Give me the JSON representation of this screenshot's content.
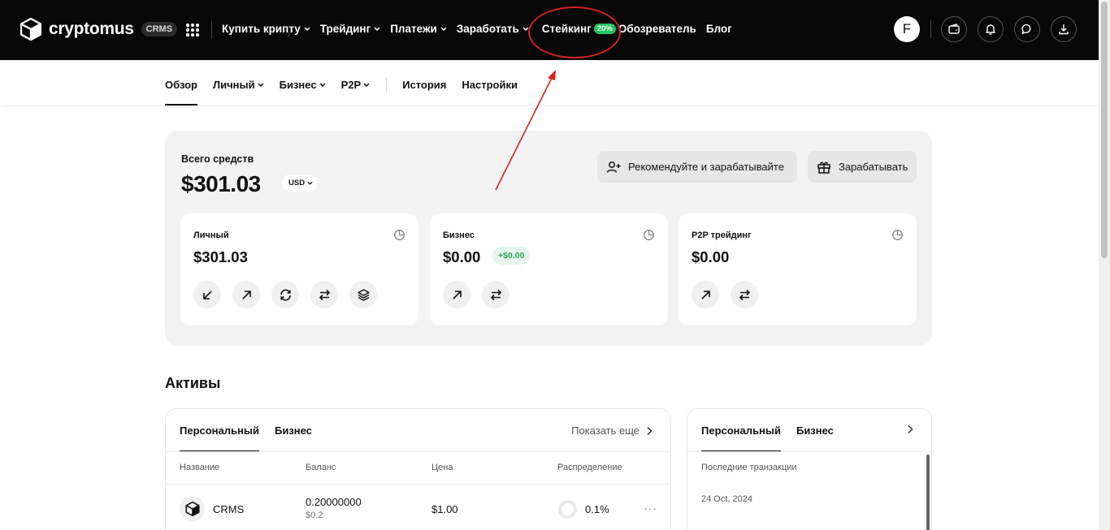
{
  "topbar": {
    "brand": "cryptomus",
    "brand_tag": "CRMS",
    "nav": [
      {
        "label": "Купить крипту",
        "dropdown": true
      },
      {
        "label": "Трейдинг",
        "dropdown": true
      },
      {
        "label": "Платежи",
        "dropdown": true
      },
      {
        "label": "Заработать",
        "dropdown": true
      },
      {
        "label": "Стейкинг",
        "badge": "20%"
      },
      {
        "label": "Обозреватель"
      },
      {
        "label": "Блог"
      }
    ],
    "avatar_letter": "F",
    "icons": [
      "wallet-icon",
      "bell-icon",
      "chat-icon",
      "download-icon"
    ]
  },
  "subnav": {
    "items": [
      {
        "label": "Обзор",
        "active": true
      },
      {
        "label": "Личный",
        "dropdown": true
      },
      {
        "label": "Бизнес",
        "dropdown": true
      },
      {
        "label": "P2P",
        "dropdown": true
      },
      {
        "label": "История"
      },
      {
        "label": "Настройки"
      }
    ]
  },
  "balance": {
    "total_label": "Всего средств",
    "total_amount": "$301.03",
    "currency": "USD",
    "refer_label": "Рекомендуйте и зарабатывайте",
    "earn_label": "Зарабатывать",
    "cards": [
      {
        "label": "Личный",
        "amount": "$301.03"
      },
      {
        "label": "Бизнес",
        "amount": "$0.00",
        "delta": "+$0.00"
      },
      {
        "label": "P2P трейдинг",
        "amount": "$0.00"
      }
    ]
  },
  "assets": {
    "title": "Активы",
    "tabs": [
      "Персональный",
      "Бизнес"
    ],
    "show_more": "Показать еще",
    "columns": [
      "Название",
      "Баланс",
      "Цена",
      "Распределение"
    ],
    "rows": [
      {
        "name": "CRMS",
        "balance": "0.20000000",
        "balance_usd": "$0.2",
        "price": "$1.00",
        "share": "0.1%"
      }
    ]
  },
  "transactions": {
    "tabs": [
      "Персональный",
      "Бизнес"
    ],
    "title": "Последние транзакции",
    "date": "24 Oct, 2024"
  },
  "colors": {
    "topbar_bg": "#070707",
    "accent_green": "#22c55e",
    "annotation_red": "#d42020"
  }
}
